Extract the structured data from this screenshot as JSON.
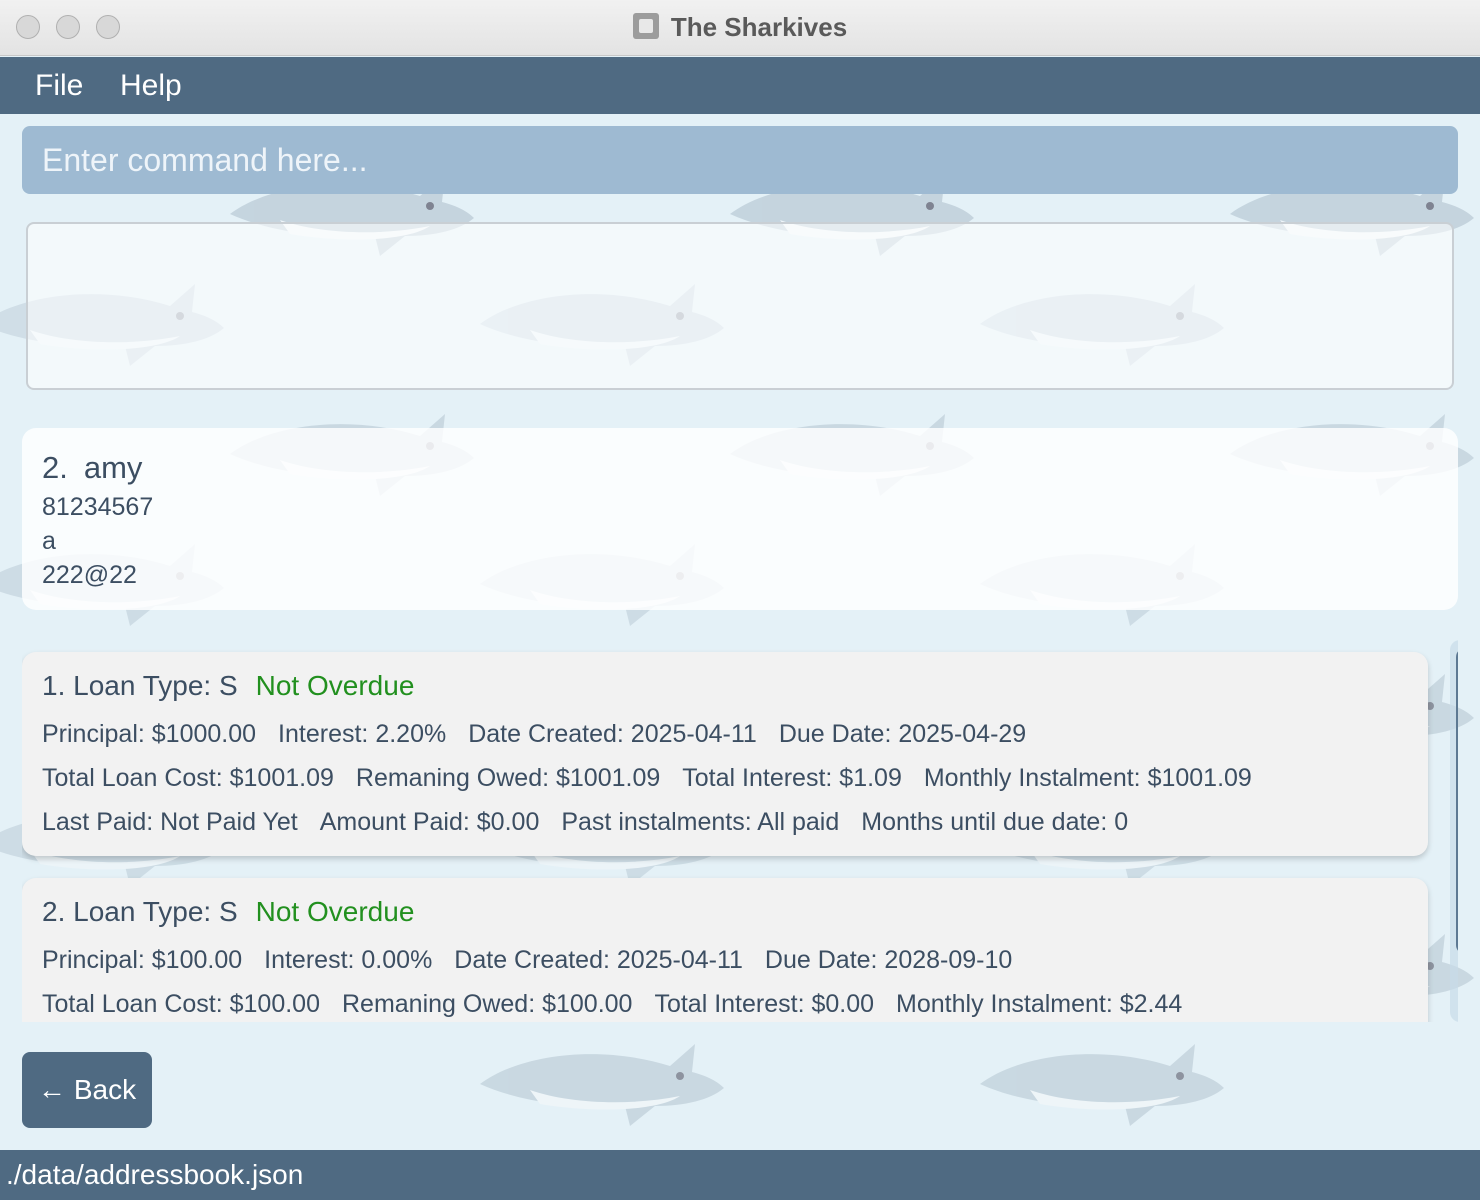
{
  "window": {
    "title": "The Sharkives"
  },
  "menu": {
    "items": [
      {
        "label": "File"
      },
      {
        "label": "Help"
      }
    ]
  },
  "command": {
    "placeholder": "Enter command here..."
  },
  "result": {
    "text": ""
  },
  "person": {
    "index": "2.",
    "name": "amy",
    "phone": "81234567",
    "address": "a",
    "email": "222@22"
  },
  "loans": [
    {
      "title": "1. Loan Type: S",
      "status": "Not Overdue",
      "principal": "Principal: $1000.00",
      "interest": "Interest: 2.20%",
      "date_created": "Date Created: 2025-04-11",
      "due_date": "Due Date: 2025-04-29",
      "total_cost": "Total Loan Cost: $1001.09",
      "remaining": "Remaning Owed: $1001.09",
      "total_interest": "Total Interest: $1.09",
      "monthly": "Monthly Instalment: $1001.09",
      "last_paid": "Last Paid: Not Paid Yet",
      "amount_paid": "Amount Paid: $0.00",
      "past_instalments": "Past instalments: All paid",
      "months_until": "Months until due date: 0"
    },
    {
      "title": "2. Loan Type: S",
      "status": "Not Overdue",
      "principal": "Principal: $100.00",
      "interest": "Interest: 0.00%",
      "date_created": "Date Created: 2025-04-11",
      "due_date": "Due Date: 2028-09-10",
      "total_cost": "Total Loan Cost: $100.00",
      "remaining": "Remaning Owed: $100.00",
      "total_interest": "Total Interest: $0.00",
      "monthly": "Monthly Instalment: $2.44"
    }
  ],
  "back_button": {
    "arrow": "←",
    "label": "Back"
  },
  "status_bar": {
    "path": "./data/addressbook.json"
  },
  "colors": {
    "accent": "#4f6a82",
    "command_bg": "#9ebad2",
    "status_ok": "#22901f"
  }
}
